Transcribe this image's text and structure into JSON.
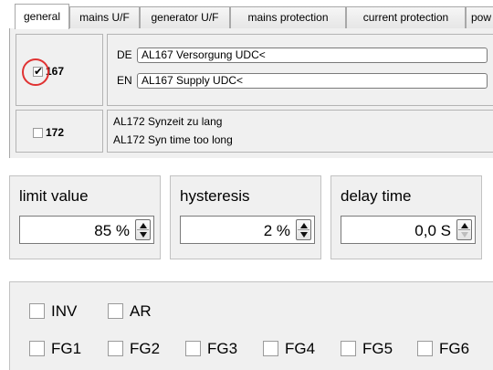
{
  "tabs": [
    {
      "label": "general",
      "active": true
    },
    {
      "label": "mains U/F",
      "active": false
    },
    {
      "label": "generator U/F",
      "active": false
    },
    {
      "label": "mains protection",
      "active": false
    },
    {
      "label": "current protection",
      "active": false
    },
    {
      "label": "pow",
      "active": false
    }
  ],
  "alarms": [
    {
      "id": "167",
      "checked": true,
      "highlighted": true,
      "texts": [
        {
          "lang": "DE",
          "value": "AL167 Versorgung UDC<"
        },
        {
          "lang": "EN",
          "value": "AL167 Supply UDC<"
        }
      ]
    },
    {
      "id": "172",
      "checked": false,
      "lines": [
        "AL172 Synzeit zu lang",
        "AL172 Syn time too long"
      ]
    }
  ],
  "settings": {
    "limit_value": {
      "title": "limit value",
      "value": "85 %"
    },
    "hysteresis": {
      "title": "hysteresis",
      "value": "2 %"
    },
    "delay_time": {
      "title": "delay time",
      "value": "0,0 S"
    }
  },
  "flags": {
    "row1": [
      {
        "label": "INV",
        "checked": false
      },
      {
        "label": "AR",
        "checked": false
      }
    ],
    "row2": [
      {
        "label": "FG1",
        "checked": false
      },
      {
        "label": "FG2",
        "checked": false
      },
      {
        "label": "FG3",
        "checked": false
      },
      {
        "label": "FG4",
        "checked": false
      },
      {
        "label": "FG5",
        "checked": false
      },
      {
        "label": "FG6",
        "checked": false
      }
    ]
  },
  "colors": {
    "highlight_circle": "#e03232",
    "panel_bg": "#f0f0f0",
    "border": "#a8a8a8"
  }
}
